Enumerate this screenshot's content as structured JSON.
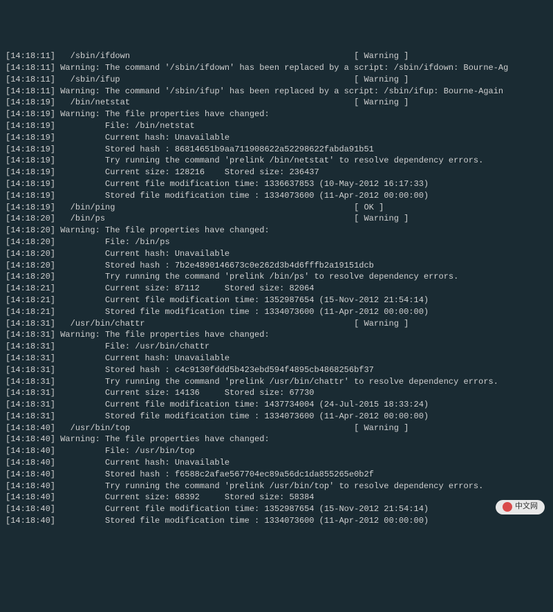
{
  "lines": [
    "[14:18:11]   /sbin/ifdown                                             [ Warning ]",
    "[14:18:11] Warning: The command '/sbin/ifdown' has been replaced by a script: /sbin/ifdown: Bourne-Ag",
    "[14:18:11]   /sbin/ifup                                               [ Warning ]",
    "[14:18:11] Warning: The command '/sbin/ifup' has been replaced by a script: /sbin/ifup: Bourne-Again ",
    "",
    "[14:18:19]   /bin/netstat                                             [ Warning ]",
    "[14:18:19] Warning: The file properties have changed:",
    "[14:18:19]          File: /bin/netstat",
    "[14:18:19]          Current hash: Unavailable",
    "[14:18:19]          Stored hash : 86814651b9aa711908622a52298622fabda91b51",
    "[14:18:19]          Try running the command 'prelink /bin/netstat' to resolve dependency errors.",
    "[14:18:19]          Current size: 128216    Stored size: 236437",
    "[14:18:19]          Current file modification time: 1336637853 (10-May-2012 16:17:33)",
    "[14:18:19]          Stored file modification time : 1334073600 (11-Apr-2012 00:00:00)",
    "[14:18:19]   /bin/ping                                                [ OK ]",
    "[14:18:20]   /bin/ps                                                  [ Warning ]",
    "[14:18:20] Warning: The file properties have changed:",
    "[14:18:20]          File: /bin/ps",
    "[14:18:20]          Current hash: Unavailable",
    "[14:18:20]          Stored hash : 7b2e4890146673c0e262d3b4d6fffb2a19151dcb",
    "[14:18:20]          Try running the command 'prelink /bin/ps' to resolve dependency errors.",
    "[14:18:21]          Current size: 87112     Stored size: 82064",
    "[14:18:21]          Current file modification time: 1352987654 (15-Nov-2012 21:54:14)",
    "[14:18:21]          Stored file modification time : 1334073600 (11-Apr-2012 00:00:00)",
    "",
    "[14:18:31]   /usr/bin/chattr                                          [ Warning ]",
    "[14:18:31] Warning: The file properties have changed:",
    "[14:18:31]          File: /usr/bin/chattr",
    "[14:18:31]          Current hash: Unavailable",
    "[14:18:31]          Stored hash : c4c9130fddd5b423ebd594f4895cb4868256bf37",
    "[14:18:31]          Try running the command 'prelink /usr/bin/chattr' to resolve dependency errors.",
    "[14:18:31]          Current size: 14136     Stored size: 67730",
    "[14:18:31]          Current file modification time: 1437734004 (24-Jul-2015 18:33:24)",
    "[14:18:31]          Stored file modification time : 1334073600 (11-Apr-2012 00:00:00)",
    "",
    "[14:18:40]   /usr/bin/top                                             [ Warning ]",
    "[14:18:40] Warning: The file properties have changed:",
    "[14:18:40]          File: /usr/bin/top",
    "[14:18:40]          Current hash: Unavailable",
    "[14:18:40]          Stored hash : f6588c2afae567704ec89a56dc1da855265e0b2f",
    "[14:18:40]          Try running the command 'prelink /usr/bin/top' to resolve dependency errors.",
    "[14:18:40]          Current size: 68392     Stored size: 58384",
    "[14:18:40]          Current file modification time: 1352987654 (15-Nov-2012 21:54:14)",
    "[14:18:40]          Stored file modification time : 1334073600 (11-Apr-2012 00:00:00)"
  ],
  "watermark": {
    "text": "中文网"
  }
}
